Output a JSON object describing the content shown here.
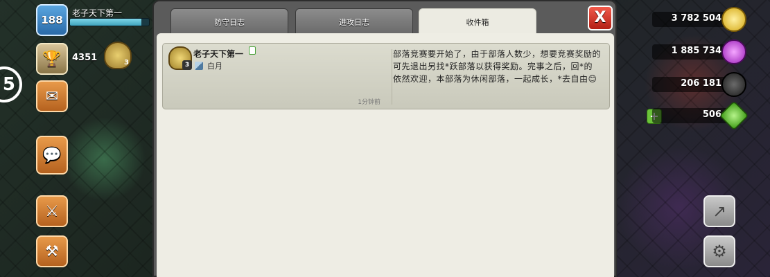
{
  "player": {
    "level": "188",
    "name": "老子天下第一",
    "xp_progress": 0.9,
    "trophies": "4351",
    "league_level": "3",
    "side_number": "5"
  },
  "resources": {
    "gold": "3 782 504",
    "elixir": "1 885 734",
    "dark_elixir": "206 181",
    "gems": "506",
    "add_gems_label": "+"
  },
  "left_hud": {
    "trophy_icon": "trophy-icon",
    "mail_icon": "mail-icon",
    "chat_icon": "chat-icon",
    "attack_icon": "swords-icon",
    "army_icon": "army-icon"
  },
  "modal": {
    "tabs": [
      {
        "label": "防守日志"
      },
      {
        "label": "进攻日志"
      },
      {
        "label": "收件箱"
      }
    ],
    "active_tab": "收件箱",
    "close_label": "X"
  },
  "inbox": {
    "messages": [
      {
        "sender_name": "老子天下第一",
        "sender_level": "3",
        "role": "白月",
        "time": "1分钟前",
        "text": "部落竞赛要开始了，由于部落人数少，想要竞赛奖励的可先退出另找*跃部落以获得奖励。完事之后，回*的依然欢迎，本部落为休闲部落，一起成长，*去自由😊"
      }
    ]
  },
  "colors": {
    "close_button": "#d9342a",
    "active_tab": "#ecebe2",
    "panel": "#eeede4"
  }
}
